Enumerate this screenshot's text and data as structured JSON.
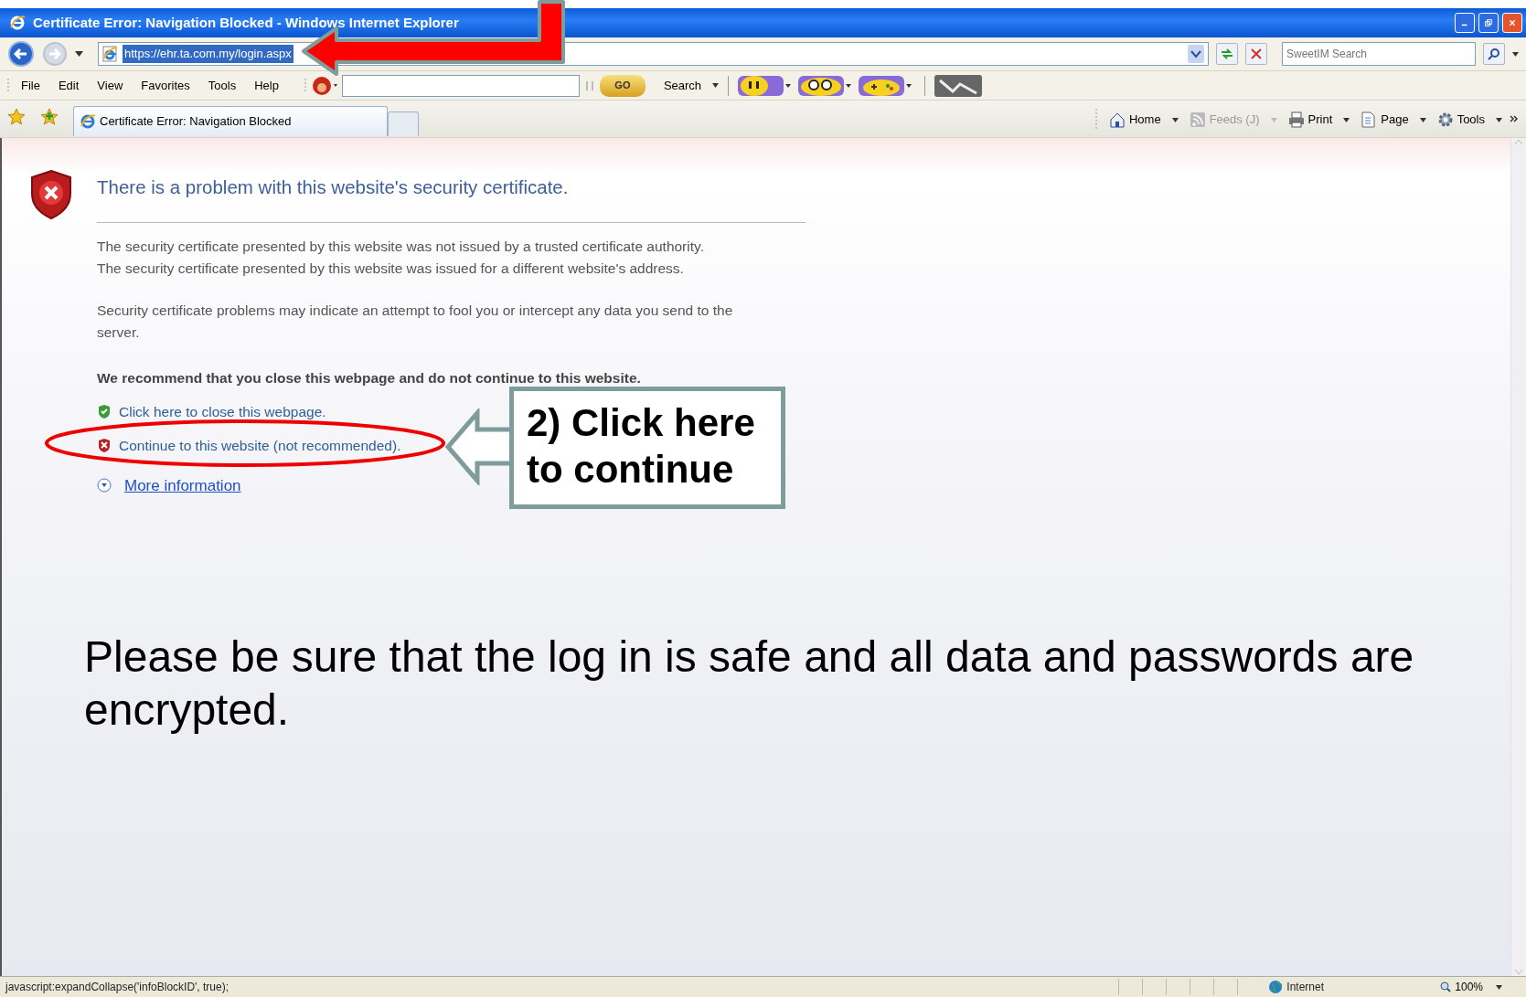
{
  "window": {
    "title": "Certificate Error: Navigation Blocked - Windows Internet Explorer"
  },
  "address_bar": {
    "url": "https://ehr.ta.com.my/login.aspx",
    "selected": true
  },
  "search_box": {
    "placeholder": "SweetIM Search"
  },
  "menu": [
    "File",
    "Edit",
    "View",
    "Favorites",
    "Tools",
    "Help"
  ],
  "toolbar": {
    "go_label": "GO",
    "search_label": "Search"
  },
  "tabs": [
    {
      "label": "Certificate Error: Navigation Blocked",
      "selected": true
    }
  ],
  "command_bar": [
    {
      "kind": "home",
      "label": "Home",
      "disabled": false
    },
    {
      "kind": "feeds",
      "label": "Feeds (J)",
      "disabled": true
    },
    {
      "kind": "print",
      "label": "Print",
      "disabled": false
    },
    {
      "kind": "page",
      "label": "Page",
      "disabled": false
    },
    {
      "kind": "tools",
      "label": "Tools",
      "disabled": false
    }
  ],
  "page": {
    "heading": "There is a problem with this website's security certificate.",
    "paragraphs": [
      [
        "The security certificate presented by this website was not issued by a trusted certificate authority.",
        "The security certificate presented by this website was issued for a different website's address."
      ],
      [
        "Security certificate problems may indicate an attempt to fool you or intercept any data you send to the server."
      ]
    ],
    "recommendation": "We recommend that you close this webpage and do not continue to this website.",
    "links": [
      {
        "kind": "close",
        "label": "Click here to close this webpage."
      },
      {
        "kind": "continue",
        "label": "Continue to this website (not recommended)."
      },
      {
        "kind": "more",
        "label": "More information"
      }
    ]
  },
  "annotation": {
    "callout": "2) Click here\nto continue",
    "note": "Please be sure that the log in is safe and all data and passwords are encrypted."
  },
  "status_bar": {
    "text": "javascript:expandCollapse('infoBlockID', true);",
    "zone": "Internet",
    "zoom": "100%"
  }
}
